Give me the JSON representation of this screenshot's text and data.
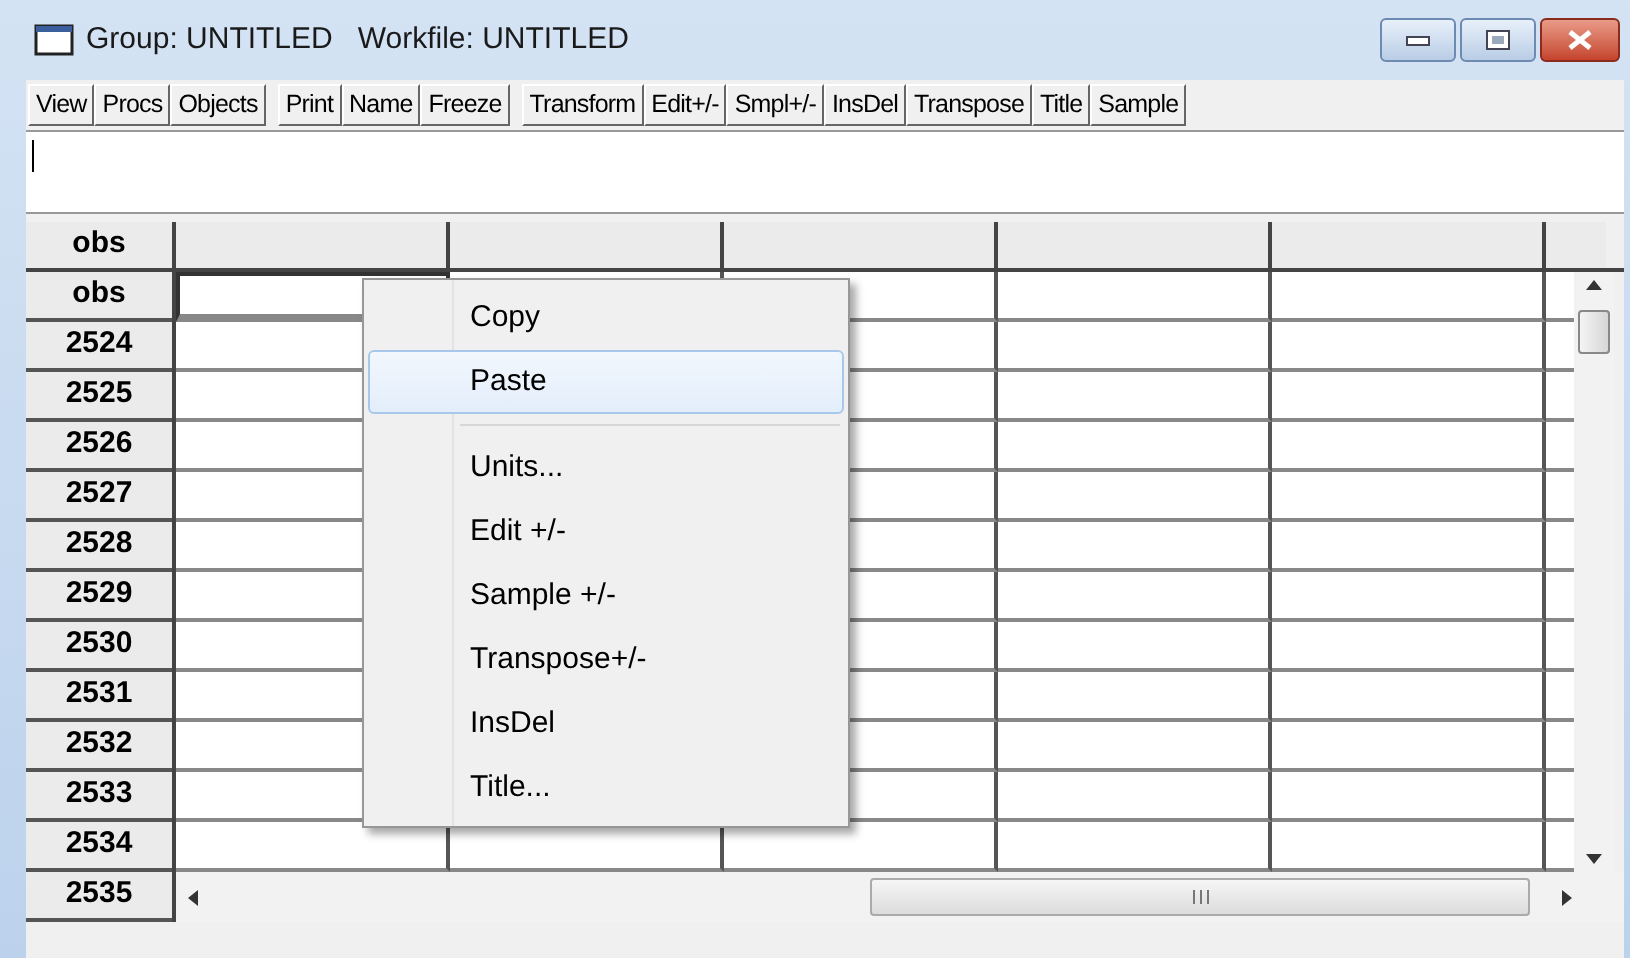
{
  "window": {
    "title": "Group: UNTITLED   Workfile: UNTITLED"
  },
  "toolbar": [
    [
      "View",
      "Procs",
      "Objects"
    ],
    [
      "Print",
      "Name",
      "Freeze"
    ],
    [
      "Transform",
      "Edit+/-",
      "Smpl+/-",
      "InsDel",
      "Transpose",
      "Title",
      "Sample"
    ]
  ],
  "grid": {
    "header_label": "obs",
    "rows": [
      {
        "label": "obs",
        "active_cell": true
      },
      {
        "label": "2524",
        "active_cell": false
      },
      {
        "label": "2525",
        "active_cell": false
      },
      {
        "label": "2526",
        "active_cell": false
      },
      {
        "label": "2527",
        "active_cell": false
      },
      {
        "label": "2528",
        "active_cell": false
      },
      {
        "label": "2529",
        "active_cell": false
      },
      {
        "label": "2530",
        "active_cell": false
      },
      {
        "label": "2531",
        "active_cell": false
      },
      {
        "label": "2532",
        "active_cell": false
      },
      {
        "label": "2533",
        "active_cell": false
      },
      {
        "label": "2534",
        "active_cell": false
      },
      {
        "label": "2535"
      }
    ]
  },
  "context_menu": [
    {
      "kind": "item",
      "label": "Copy",
      "selected": false
    },
    {
      "kind": "item",
      "label": "Paste",
      "selected": true
    },
    {
      "kind": "separator"
    },
    {
      "kind": "item",
      "label": "Units...",
      "selected": false
    },
    {
      "kind": "item",
      "label": "Edit +/-",
      "selected": false
    },
    {
      "kind": "item",
      "label": "Sample +/-",
      "selected": false
    },
    {
      "kind": "item",
      "label": "Transpose+/-",
      "selected": false
    },
    {
      "kind": "item",
      "label": "InsDel",
      "selected": false
    },
    {
      "kind": "item",
      "label": "Title...",
      "selected": false
    }
  ]
}
